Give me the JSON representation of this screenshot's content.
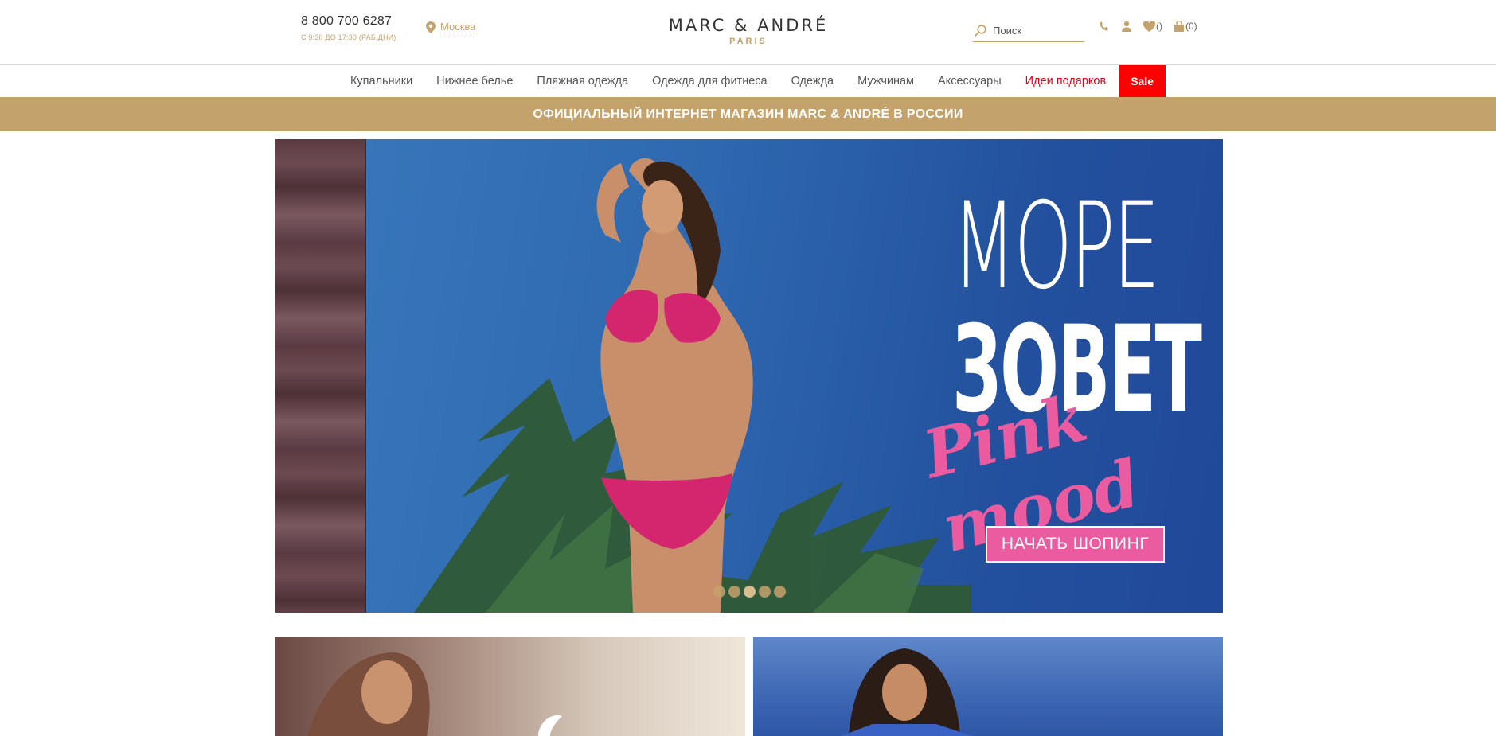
{
  "header": {
    "phone": "8 800 700 6287",
    "hours": "С 9:30 ДО 17:30 (РАБ.ДНИ)",
    "city": "Москва",
    "logo": {
      "main": "MARC & ANDRÉ",
      "sub": "PARIS"
    },
    "search": {
      "placeholder": "Поиск",
      "value": ""
    },
    "icons": {
      "phone": "phone-icon",
      "account": "user-icon",
      "wishlist": "heart-icon",
      "cart": "bag-icon"
    },
    "wishlist_count": "()",
    "cart_count": "(0)"
  },
  "nav": {
    "items": [
      {
        "label": "Купальники"
      },
      {
        "label": "Нижнее белье"
      },
      {
        "label": "Пляжная одежда"
      },
      {
        "label": "Одежда для фитнеса"
      },
      {
        "label": "Одежда"
      },
      {
        "label": "Мужчинам"
      },
      {
        "label": "Аксессуары"
      },
      {
        "label": "Идеи подарков"
      },
      {
        "label": "Sale"
      }
    ]
  },
  "strip": {
    "text": "ОФИЦИАЛЬНЫЙ ИНТЕРНЕТ МАГАЗИН MARC & ANDRÉ В РОССИИ"
  },
  "hero": {
    "line1": "МОРЕ",
    "line2": "ЗОВЕТ",
    "script": "Pink mood",
    "cta": "НАЧАТЬ ШОПИНГ",
    "slides_total": 5,
    "active_slide": 3
  },
  "colors": {
    "accent": "#c4a26c",
    "sale": "#ff0000",
    "gifts": "#e0001a",
    "pink": "#ea5b9f"
  }
}
